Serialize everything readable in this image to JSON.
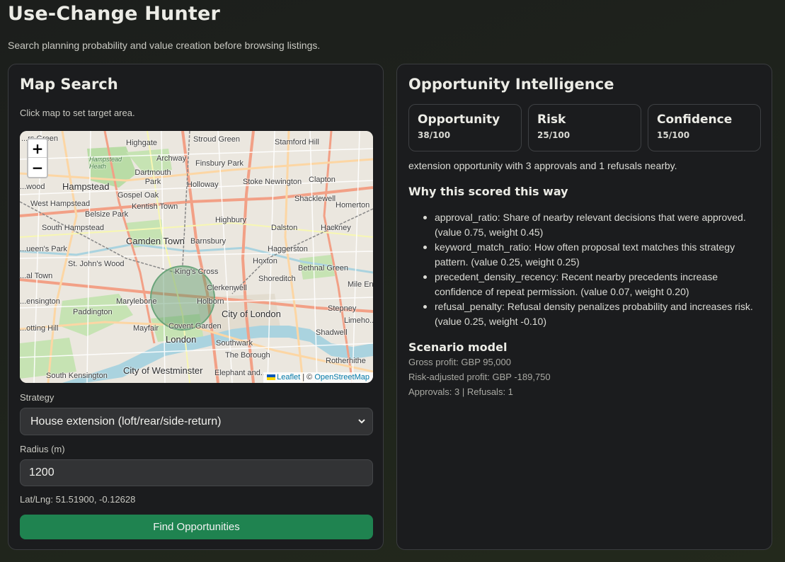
{
  "header": {
    "title": "Use-Change Hunter",
    "subtitle": "Search planning probability and value creation before browsing listings."
  },
  "map_search": {
    "title": "Map Search",
    "hint": "Click map to set target area.",
    "zoom_in": "+",
    "zoom_out": "−",
    "attribution": {
      "leaflet": "Leaflet",
      "separator": " | © ",
      "osm": "OpenStreetMap"
    },
    "places": {
      "highgate": "Highgate",
      "stroud_green": "Stroud Green",
      "stamford_hill": "Stamford Hill",
      "harringay": "...rs Green",
      "hampstead_heath": "Hampstead Heath",
      "archway": "Archway",
      "finsbury_park": "Finsbury Park",
      "dartmouth_park": "Dartmouth Park",
      "hampstead": "Hampstead",
      "gospel_oak": "Gospel Oak",
      "holloway": "Holloway",
      "stoke_newington": "Stoke Newington",
      "clapton": "Clapton",
      "wood": "...wood",
      "west_hampstead": "West Hampstead",
      "kentish_town": "Kentish Town",
      "shacklewell": "Shacklewell",
      "belsize_park": "Belsize Park",
      "homerton": "Homerton",
      "south_hampstead": "South Hampstead",
      "highbury": "Highbury",
      "dalston": "Dalston",
      "hackney": "Hackney",
      "camden_town": "Camden Town",
      "barnsbury": "Barnsbury",
      "queens_park": "...ueen's Park",
      "haggerston": "Haggerston",
      "st_johns_wood": "St. John's Wood",
      "hoxton": "Hoxton",
      "bethnal_green": "Bethnal Green",
      "kings_cross": "King's Cross",
      "maida_vale": "...al Town",
      "shoreditch": "Shoreditch",
      "mile_end": "Mile En...",
      "clerkenwell": "Clerkenwell",
      "kensington_north": "...ensington",
      "marylebone": "Marylebone",
      "holborn": "Holborn",
      "paddington": "Paddington",
      "city_of_london": "City of London",
      "stepney": "Stepney",
      "limehouse": "Limeho...",
      "notting_hill": "...otting Hill",
      "mayfair": "Mayfair",
      "covent_garden": "Covent Garden",
      "shadwell": "Shadwell",
      "london": "London",
      "southwark": "Southwark",
      "the_borough": "The Borough",
      "rotherhithe": "Rotherhithe",
      "city_of_westminster": "City of Westminster",
      "elephant": "Elephant and...",
      "south_kensington": "South Kensington"
    },
    "strategy_label": "Strategy",
    "strategy_value": "House extension (loft/rear/side-return)",
    "radius_label": "Radius (m)",
    "radius_value": "1200",
    "latlng": "Lat/Lng: 51.51900, -0.12628",
    "find_button": "Find Opportunities"
  },
  "intelligence": {
    "title": "Opportunity Intelligence",
    "metrics": [
      {
        "name": "Opportunity",
        "value": "38/100"
      },
      {
        "name": "Risk",
        "value": "25/100"
      },
      {
        "name": "Confidence",
        "value": "15/100"
      }
    ],
    "summary": "extension opportunity with 3 approvals and 1 refusals nearby.",
    "why_title": "Why this scored this way",
    "reasons": [
      "approval_ratio: Share of nearby relevant decisions that were approved. (value 0.75, weight 0.45)",
      "keyword_match_ratio: How often proposal text matches this strategy pattern. (value 0.25, weight 0.25)",
      "precedent_density_recency: Recent nearby precedents increase confidence of repeat permission. (value 0.07, weight 0.20)",
      "refusal_penalty: Refusal density penalizes probability and increases risk. (value 0.25, weight -0.10)"
    ],
    "scenario_title": "Scenario model",
    "gross_profit": "Gross profit: GBP 95,000",
    "risk_adjusted_profit": "Risk-adjusted profit: GBP -189,750",
    "counts": "Approvals: 3 | Refusals: 1"
  },
  "colors": {
    "accent_button": "#1f8350",
    "panel_bg": "#1b1c1e",
    "radius_circle": "#5a9a6a"
  },
  "icons": [
    "chevron-down-icon",
    "ukraine-flag-icon"
  ]
}
